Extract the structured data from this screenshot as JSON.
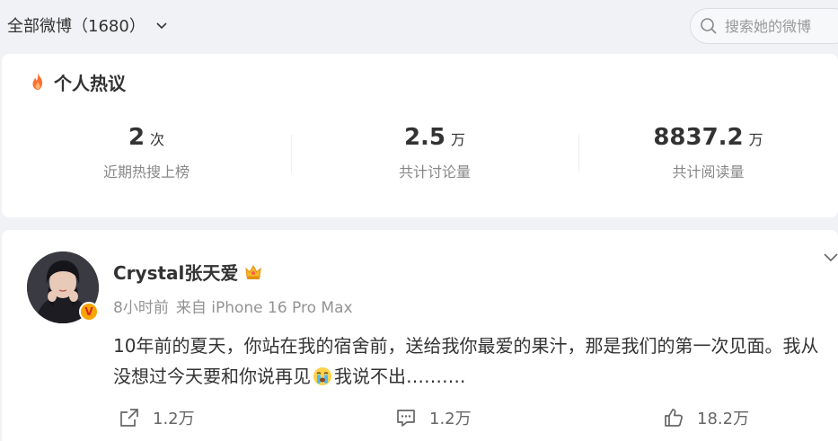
{
  "feed_filter": {
    "label": "全部微博",
    "count": "1680"
  },
  "search": {
    "placeholder": "搜索她的微博"
  },
  "hot_discussion": {
    "title": "个人热议",
    "stats": [
      {
        "value": "2",
        "unit": "次",
        "label": "近期热搜上榜"
      },
      {
        "value": "2.5",
        "unit": "万",
        "label": "共计讨论量"
      },
      {
        "value": "8837.2",
        "unit": "万",
        "label": "共计阅读量"
      }
    ]
  },
  "post": {
    "username": "Crystal张天爱",
    "verified_badge": "V",
    "time": "8小时前",
    "source": "iPhone 16 Pro Max",
    "text_part1": "10年前的夏天，你站在我的宿舍前，送给我你最爱的果汁，那是我们的第一次见面。我从没想过今天要和你说再见",
    "emoji": "crying-face-icon",
    "text_part2": "我说不出……….",
    "actions": {
      "reposts": "1.2万",
      "comments": "1.2万",
      "likes": "18.2万"
    }
  },
  "colors": {
    "page_background": "#f1f2f5",
    "card_background": "#ffffff",
    "fire_icon": "#ff6d2e",
    "badge": "#f7a400",
    "muted_text": "#939393"
  }
}
